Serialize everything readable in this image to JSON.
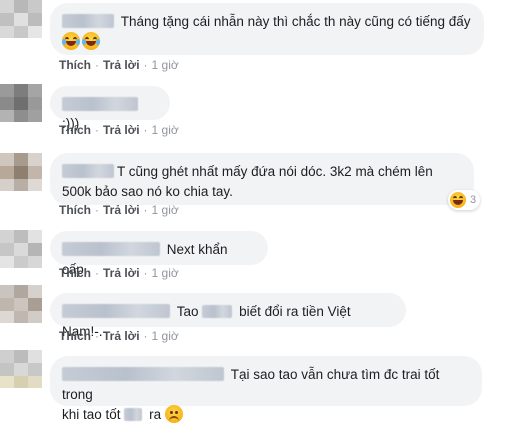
{
  "actions": {
    "like": "Thích",
    "reply": "Trả lời",
    "separator": "·"
  },
  "comments": [
    {
      "text": "Tháng tặng cái nhẫn này thì chắc th này cũng có tiếng đấy",
      "time": "1 giờ",
      "emojis": [
        "laughing-crying",
        "laughing-crying"
      ]
    },
    {
      "text": ":)))",
      "time": "1 giờ"
    },
    {
      "text_line1": "T cũng ghét nhất mấy đứa nói dóc. 3k2 mà chém lên",
      "text_line2": "500k bảo sao nó ko chia tay.",
      "time": "1 giờ",
      "reaction_count": "3"
    },
    {
      "text": "Next khẩn cấp.",
      "time": "1 giờ"
    },
    {
      "text_before": "Tao",
      "text_after": "biết đổi ra tiền Việt Nam!-.-",
      "time": "1 giờ"
    },
    {
      "text_line1": "Tại sao tao vẫn chưa tìm đc trai tốt trong",
      "text_line2_before": "khi tao tốt",
      "text_line2_after": "ra",
      "emoji": "sad-face"
    }
  ]
}
